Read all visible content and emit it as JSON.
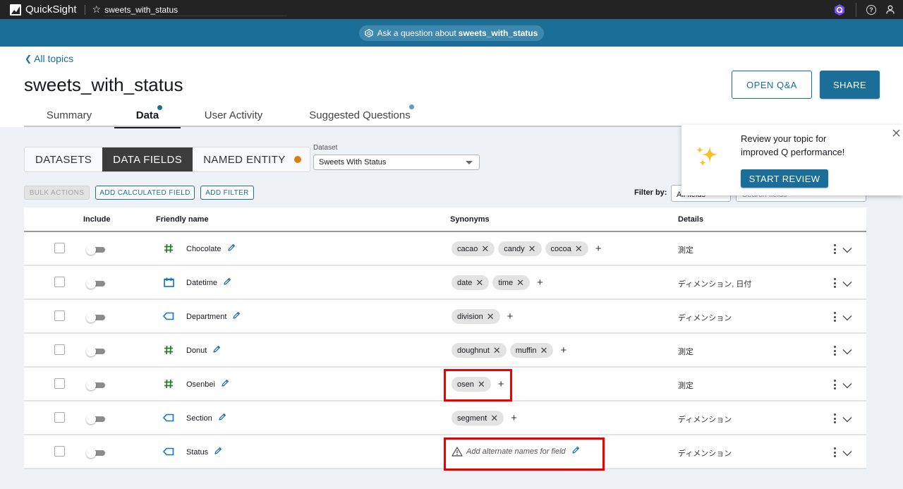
{
  "topbar": {
    "app_name": "QuickSight",
    "topic_name": "sweets_with_status",
    "icons": [
      "quicksight-logo-icon",
      "star-icon",
      "q-hexagon-icon",
      "help-icon",
      "user-icon"
    ]
  },
  "askbar": {
    "prefix": "Ask a question about",
    "topic": "sweets_with_status",
    "icon": "q-icon"
  },
  "header": {
    "back_label": "All topics",
    "title": "sweets_with_status",
    "open_qa_label": "OPEN Q&A",
    "share_label": "SHARE",
    "tabs": [
      {
        "label": "Summary",
        "active": false,
        "dot": false
      },
      {
        "label": "Data",
        "active": true,
        "dot": true
      },
      {
        "label": "User Activity",
        "active": false,
        "dot": false
      },
      {
        "label": "Suggested Questions",
        "active": false,
        "dot": true
      }
    ]
  },
  "segmented": {
    "items": [
      {
        "label": "DATASETS",
        "active": false
      },
      {
        "label": "DATA FIELDS",
        "active": true
      },
      {
        "label": "NAMED ENTITY",
        "active": false,
        "dot": true
      }
    ]
  },
  "dataset": {
    "label": "Dataset",
    "selected": "Sweets With Status"
  },
  "actions": {
    "bulk_actions": "BULK ACTIONS",
    "add_calculated_field": "ADD CALCULATED FIELD",
    "add_filter": "ADD FILTER"
  },
  "filter": {
    "label": "Filter by:",
    "selected": "All fields",
    "search_placeholder": "Search fields"
  },
  "table": {
    "columns": {
      "include": "Include",
      "friendly_name": "Friendly name",
      "synonyms": "Synonyms",
      "details": "Details"
    },
    "rows": [
      {
        "name": "Chocolate",
        "type": "measure",
        "synonyms": [
          "cacao",
          "candy",
          "cocoa"
        ],
        "details": "測定",
        "included": false
      },
      {
        "name": "Datetime",
        "type": "date",
        "synonyms": [
          "date",
          "time"
        ],
        "details": "ディメンション, 日付",
        "included": false
      },
      {
        "name": "Department",
        "type": "dimension",
        "synonyms": [
          "division"
        ],
        "details": "ディメンション",
        "included": false
      },
      {
        "name": "Donut",
        "type": "measure",
        "synonyms": [
          "doughnut",
          "muffin"
        ],
        "details": "測定",
        "included": false
      },
      {
        "name": "Osenbei",
        "type": "measure",
        "synonyms": [
          "osen"
        ],
        "details": "測定",
        "included": false
      },
      {
        "name": "Section",
        "type": "dimension",
        "synonyms": [
          "segment"
        ],
        "details": "ディメンション",
        "included": false
      },
      {
        "name": "Status",
        "type": "dimension",
        "synonyms": [],
        "details": "ディメンション",
        "included": false,
        "placeholder": "Add alternate names for field"
      }
    ]
  },
  "popover": {
    "line1": "Review your topic for",
    "line2": "improved Q performance!",
    "button": "START REVIEW"
  },
  "colors": {
    "brand": "#1b6e98",
    "topbar": "#232323",
    "measure_icon": "#2e7d32",
    "dimension_icon": "#0972d3",
    "named_entity_dot": "#d4830f",
    "highlight": "#ee0000"
  }
}
